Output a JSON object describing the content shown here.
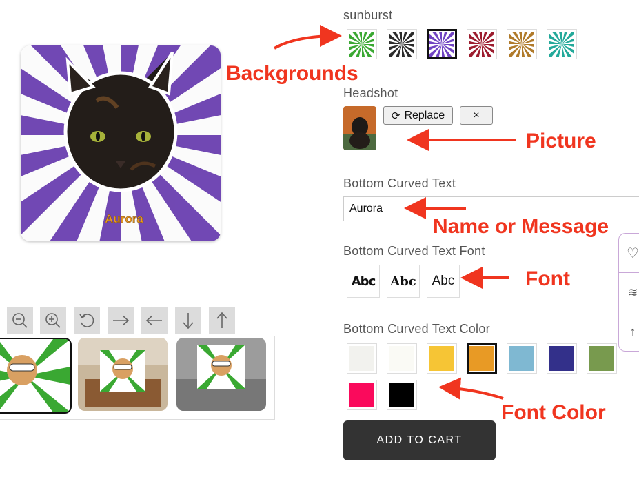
{
  "preview": {
    "pillow_text": "Aurora",
    "bg_color": "#6a3fb0"
  },
  "toolbar": {
    "icons": [
      "zoom-out-icon",
      "zoom-in-icon",
      "rotate-icon",
      "arrow-right-icon",
      "arrow-left-icon",
      "arrow-down-icon",
      "arrow-up-icon"
    ]
  },
  "thumbnails": [
    {
      "name": "front-view"
    },
    {
      "name": "chair-view"
    },
    {
      "name": "sofa-view"
    }
  ],
  "background": {
    "label": "sunburst",
    "swatches": [
      {
        "color": "#3aa832",
        "selected": false
      },
      {
        "color": "#2b2b2b",
        "selected": false
      },
      {
        "color": "#7043c2",
        "selected": true
      },
      {
        "color": "#9c1c2e",
        "selected": false
      },
      {
        "color": "#b07a2a",
        "selected": false
      },
      {
        "color": "#23a99a",
        "selected": false
      }
    ]
  },
  "headshot": {
    "label": "Headshot",
    "replace_label": "Replace",
    "remove_label": "×"
  },
  "bottom_text": {
    "label": "Bottom Curved Text",
    "value": "Aurora"
  },
  "font": {
    "label": "Bottom Curved Text Font",
    "options": [
      "Abc",
      "Abc",
      "Abc"
    ]
  },
  "color": {
    "label": "Bottom Curved Text Color",
    "swatches": [
      {
        "color": "#f2f2ee",
        "selected": false
      },
      {
        "color": "#fafaf5",
        "selected": false
      },
      {
        "color": "#f6c535",
        "selected": false
      },
      {
        "color": "#e89a25",
        "selected": true
      },
      {
        "color": "#7fb8d2",
        "selected": false
      },
      {
        "color": "#33308a",
        "selected": false
      },
      {
        "color": "#789a4e",
        "selected": false
      },
      {
        "color": "#fa0a5c",
        "selected": false
      },
      {
        "color": "#000000",
        "selected": false
      }
    ]
  },
  "cart": {
    "label": "ADD TO CART"
  },
  "annotations": {
    "backgrounds": "Backgrounds",
    "picture": "Picture",
    "name": "Name or Message",
    "font": "Font",
    "font_color": "Font Color"
  }
}
